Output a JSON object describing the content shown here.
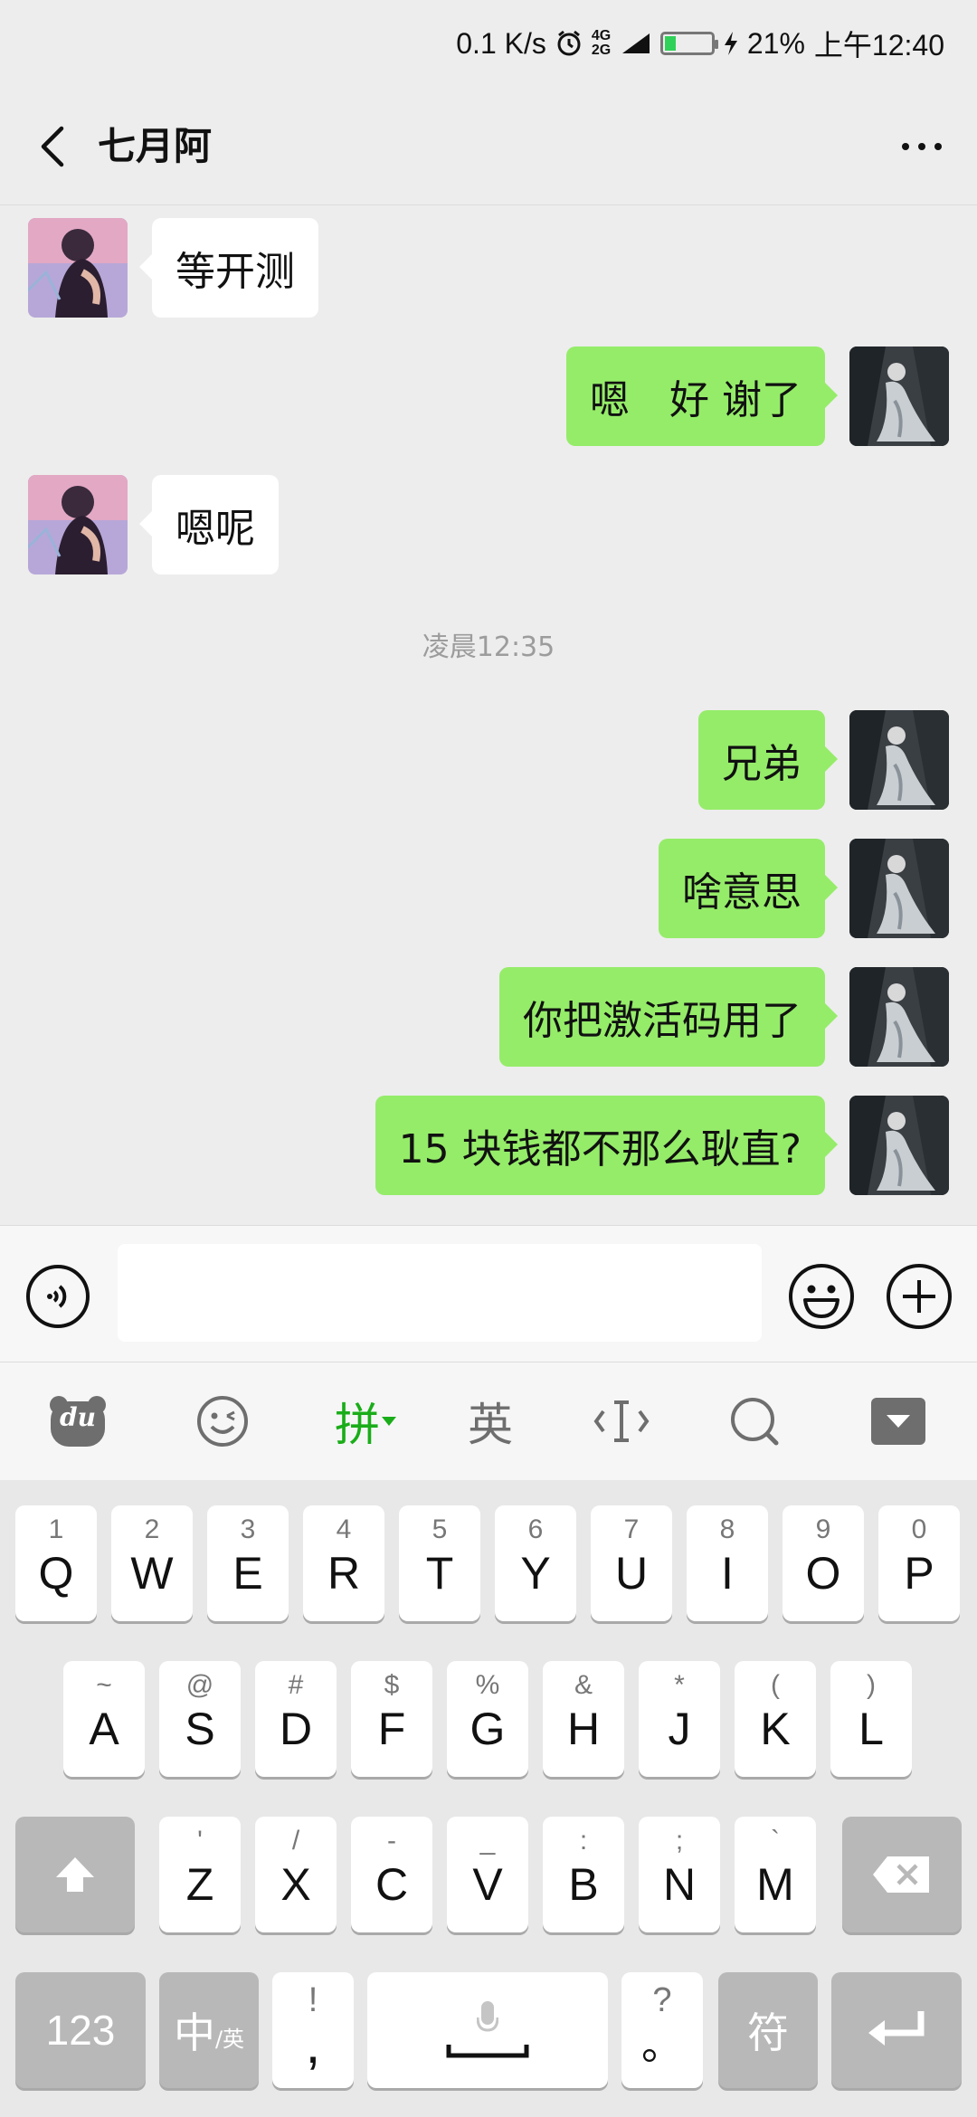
{
  "status_bar": {
    "speed": "0.1 K/s",
    "network": "4G 2G",
    "battery": "21%",
    "time": "上午12:40"
  },
  "header": {
    "title": "七月阿"
  },
  "messages": [
    {
      "side": "left",
      "text": "等开测"
    },
    {
      "side": "right",
      "text": "嗯　好 谢了"
    },
    {
      "side": "left",
      "text": "嗯呢"
    },
    {
      "timestamp": "凌晨12:35"
    },
    {
      "side": "right",
      "text": "兄弟"
    },
    {
      "side": "right",
      "text": "啥意思"
    },
    {
      "side": "right",
      "text": "你把激活码用了"
    },
    {
      "side": "right",
      "text": "15 块钱都不那么耿直?"
    }
  ],
  "input": {
    "value": "",
    "placeholder": ""
  },
  "ime_toolbar": {
    "logo": "du",
    "pinyin_label": "拼",
    "english_label": "英"
  },
  "keyboard": {
    "row1": [
      {
        "main": "Q",
        "sub": "1"
      },
      {
        "main": "W",
        "sub": "2"
      },
      {
        "main": "E",
        "sub": "3"
      },
      {
        "main": "R",
        "sub": "4"
      },
      {
        "main": "T",
        "sub": "5"
      },
      {
        "main": "Y",
        "sub": "6"
      },
      {
        "main": "U",
        "sub": "7"
      },
      {
        "main": "I",
        "sub": "8"
      },
      {
        "main": "O",
        "sub": "9"
      },
      {
        "main": "P",
        "sub": "0"
      }
    ],
    "row2": [
      {
        "main": "A",
        "sub": "~"
      },
      {
        "main": "S",
        "sub": "@"
      },
      {
        "main": "D",
        "sub": "#"
      },
      {
        "main": "F",
        "sub": "$"
      },
      {
        "main": "G",
        "sub": "%"
      },
      {
        "main": "H",
        "sub": "&"
      },
      {
        "main": "J",
        "sub": "*"
      },
      {
        "main": "K",
        "sub": "("
      },
      {
        "main": "L",
        "sub": ")"
      }
    ],
    "row3": [
      {
        "main": "Z",
        "sub": "'"
      },
      {
        "main": "X",
        "sub": "/"
      },
      {
        "main": "C",
        "sub": "-"
      },
      {
        "main": "V",
        "sub": "_"
      },
      {
        "main": "B",
        "sub": ":"
      },
      {
        "main": "N",
        "sub": ";"
      },
      {
        "main": "M",
        "sub": "`"
      }
    ],
    "row4": {
      "num": "123",
      "lang_main": "中",
      "lang_sub": "/英",
      "comma_main": ",",
      "comma_sub": "!",
      "period_main": "。",
      "period_sub": "?",
      "symbol": "符"
    }
  },
  "colors": {
    "bubble_left": "#ffffff",
    "bubble_right": "#95ec69",
    "ime_accent": "#1aad19"
  }
}
